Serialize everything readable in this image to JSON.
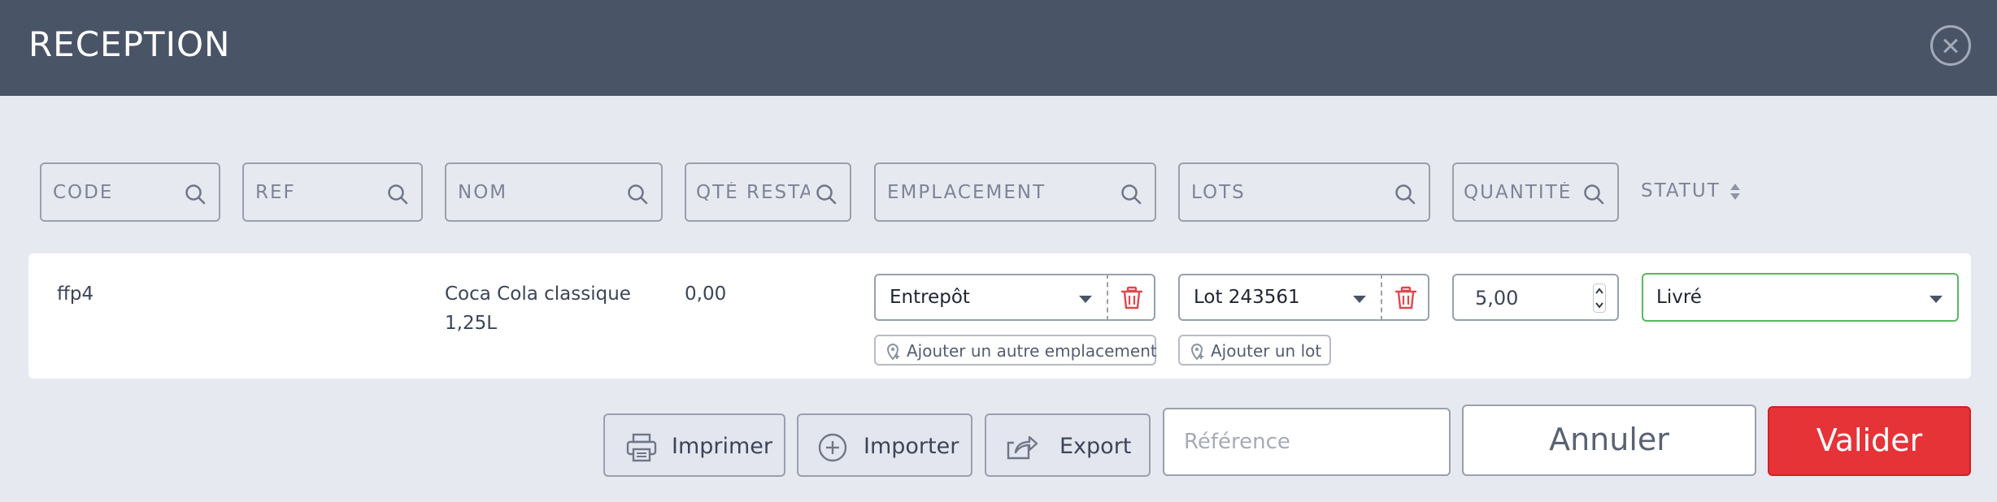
{
  "header": {
    "title": "RECEPTION"
  },
  "filters": {
    "code": "CODE",
    "ref": "REF",
    "nom": "NOM",
    "qte_restante": "QTÉ RESTANTE",
    "emplacement": "EMPLACEMENT",
    "lots": "LOTS",
    "quantite": "QUANTITÉ",
    "statut": "STATUT"
  },
  "row": {
    "code": "ffp4",
    "nom_line1": "Coca Cola classique",
    "nom_line2": "1,25L",
    "qte_restante": "0,00",
    "emplacement": "Entrepôt",
    "add_emplacement": "Ajouter un autre emplacement",
    "lot": "Lot 243561",
    "add_lot": "Ajouter un lot",
    "quantite": "5,00",
    "statut": "Livré"
  },
  "footer": {
    "imprimer": "Imprimer",
    "importer": "Importer",
    "export": "Export",
    "reference_placeholder": "Référence",
    "annuler": "Annuler",
    "valider": "Valider"
  },
  "colors": {
    "header_bg": "#4a5467",
    "page_bg": "#e7e9f1",
    "status_border": "#59b860",
    "validate_bg": "#e53337",
    "trash_icon": "#e0474c"
  }
}
